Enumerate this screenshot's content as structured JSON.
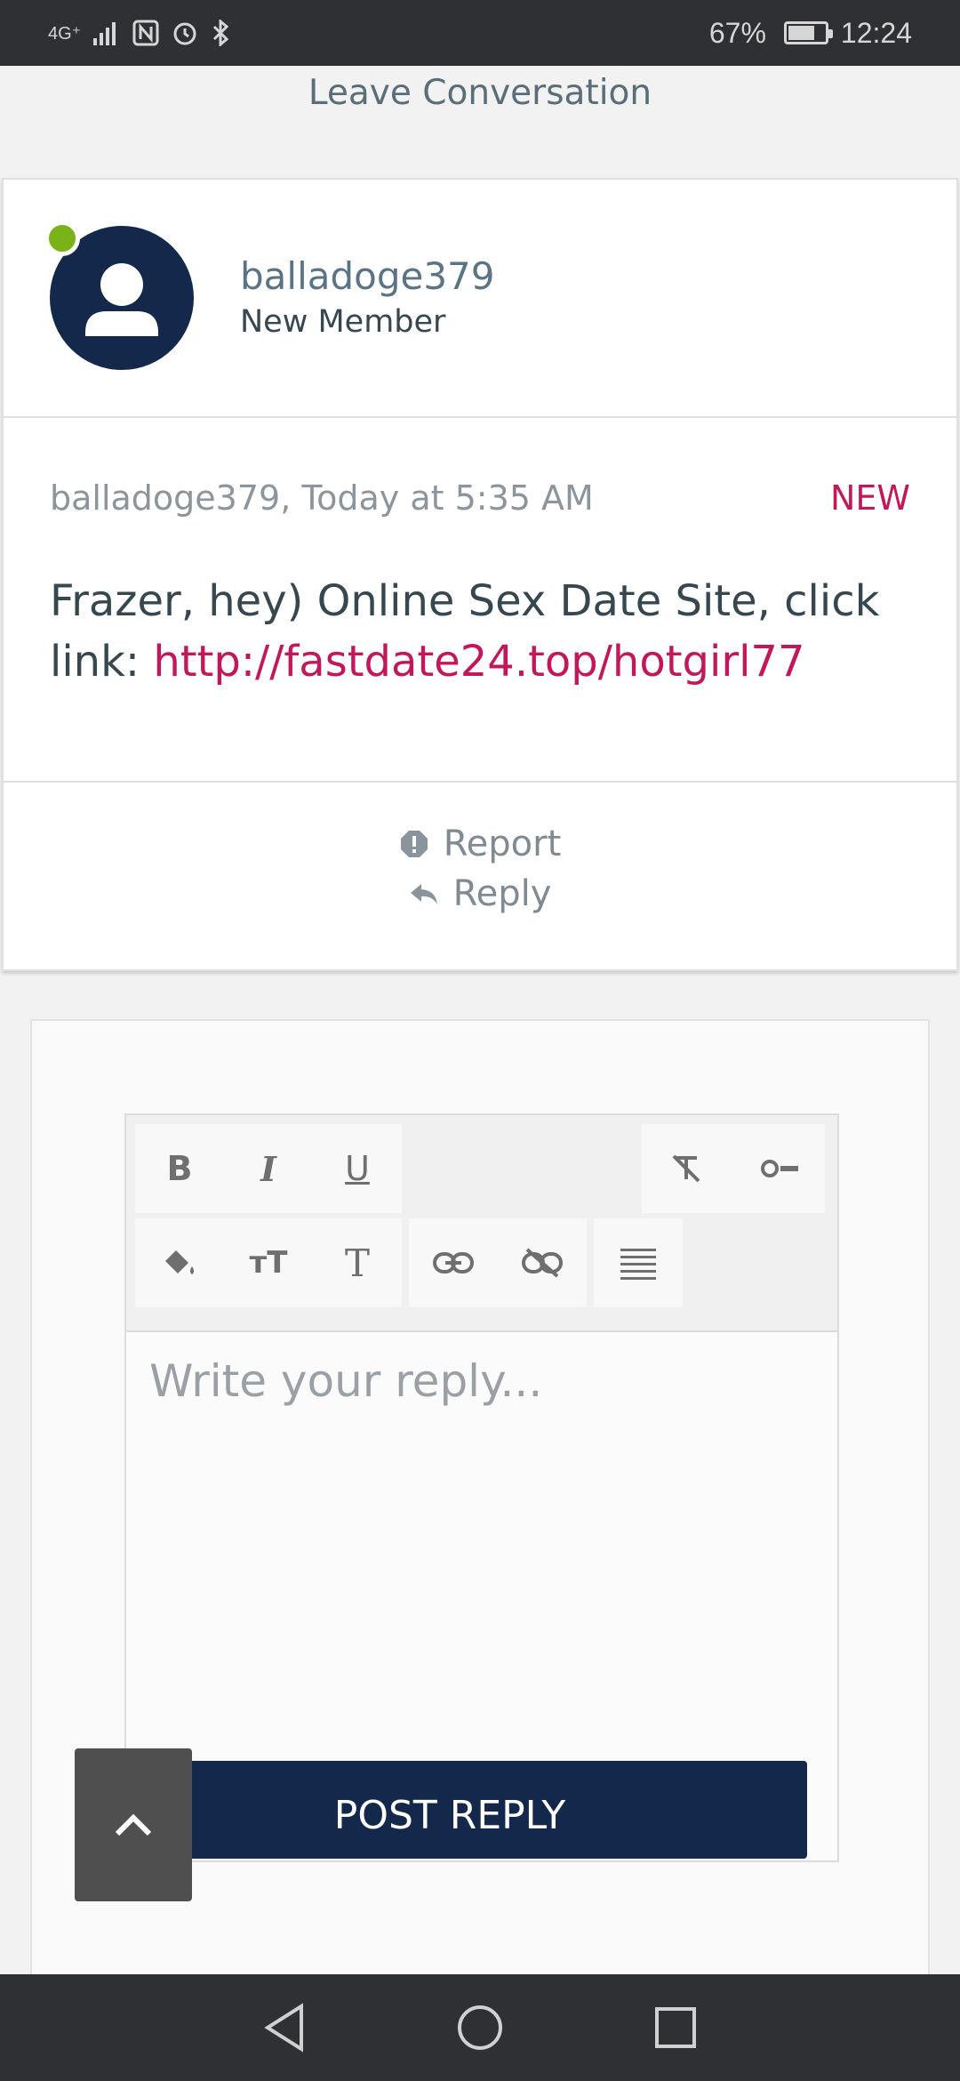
{
  "status_bar": {
    "network": "4G⁺",
    "battery_percent": "67%",
    "battery_level": 0.67,
    "time": "12:24"
  },
  "header": {
    "leave_label": "Leave Conversation"
  },
  "message": {
    "username": "balladoge379",
    "user_title": "New Member",
    "online": true,
    "meta": "balladoge379, Today at 5:35 AM",
    "badge": "NEW",
    "text_prefix": "Frazer, hey) Online Sex Date Site, click link: ",
    "link_text": "http://fastdate24.top/hotgirl77",
    "actions": {
      "report_label": "Report",
      "reply_label": "Reply"
    }
  },
  "reply_form": {
    "toolbar": {
      "bold": "B",
      "italic": "I",
      "underline": "U",
      "font_size": "тT",
      "font_family": "T"
    },
    "placeholder": "Write your reply...",
    "submit_label": "POST REPLY"
  },
  "colors": {
    "accent": "#c2185b",
    "brand_navy": "#13284a",
    "online": "#7ab317"
  }
}
